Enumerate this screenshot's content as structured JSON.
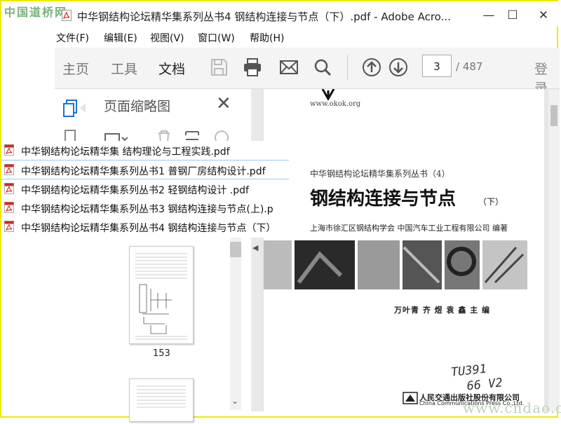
{
  "watermark_top": "中国道桥网",
  "watermark_bottom": "www.cndao.com",
  "window": {
    "title": "中华钢结构论坛精华集系列丛书4 钢结构连接与节点（下）.pdf - Adobe Acro...",
    "minimize": "—",
    "maximize": "☐",
    "close": "✕"
  },
  "menu": [
    "文件(F)",
    "编辑(E)",
    "视图(V)",
    "窗口(W)",
    "帮助(H)"
  ],
  "toolbar": {
    "tabs": [
      "主页",
      "工具",
      "文档"
    ],
    "active_tab": "文档",
    "page_current": "3",
    "page_total": "/ 487",
    "login": "登录"
  },
  "thumbnails": {
    "title": "页面缩略图",
    "page_label": "153"
  },
  "files": [
    {
      "name": "中华钢结构论坛精华集 结构理论与工程实践.pdf",
      "selected": false
    },
    {
      "name": "中华钢结构论坛精华集系列丛书1 普钢厂房结构设计.pdf",
      "selected": true
    },
    {
      "name": "中华钢结构论坛精华集系列丛书2 轻钢结构设计 .pdf",
      "selected": false
    },
    {
      "name": "中华钢结构论坛精华集系列丛书3 钢结构连接与节点(上).p",
      "selected": false
    },
    {
      "name": "中华钢结构论坛精华集系列丛书4 钢结构连接与节点（下）",
      "selected": false
    }
  ],
  "document": {
    "url": "www.okok.org",
    "series": "中华钢结构论坛精华集系列丛书（4）",
    "title": "钢结构连接与节点",
    "title_suffix": "（下）",
    "org": "上海市徐汇区钢结构学会   中国汽车工业工程有限公司   编著",
    "editors": "万叶青  齐  煜  袁  鑫    主  编",
    "handwriting": "TU391\n  66 V2",
    "publisher": "人民交通出版社股份有限公司",
    "publisher_en": "China Communications Press Co.,Ltd."
  },
  "colors": {
    "frame": "#f2e600",
    "pdf_red": "#d22a1e",
    "select_border": "#9ac8f0"
  }
}
